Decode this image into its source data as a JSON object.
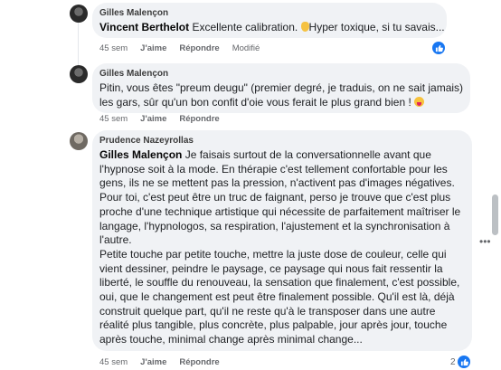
{
  "comments": [
    {
      "author": "Gilles Malençon",
      "mention": "Vincent Berthelot",
      "text": " Excellente calibration. ",
      "text_after": "Hyper toxique, si tu savais...",
      "emoji": "hand-emoji",
      "time": "45 sem",
      "like": "J'aime",
      "reply": "Répondre",
      "modified": "Modifié",
      "reaction_icon": "thumbs-up-icon"
    },
    {
      "author": "Gilles Malençon",
      "text_lines": [
        "Pitin, vous êtes \"preum deugu\" (premier degré, je traduis, on ne sait jamais)",
        "les gars, sûr qu'un bon confit d'oie vous ferait le plus grand bien ! "
      ],
      "emoji": "tongue-out-emoji",
      "time": "45 sem",
      "like": "J'aime",
      "reply": "Répondre"
    },
    {
      "author": "Prudence Nazeyrollas",
      "mention": "Gilles Malençon",
      "paragraph1_start": " Je faisais surtout de la conversationnelle avant que",
      "paragraph1_lines": [
        "l'hypnose soit à la mode. En thérapie c'est tellement confortable pour les",
        "gens, ils ne se mettent pas la pression, n'activent pas d'images négatives.",
        "Pour toi, c'est peut être un truc de faignant, perso je trouve que c'est plus",
        "proche d'une technique artistique qui nécessite de parfaitement maîtriser le",
        "langage, l'hypnologos, sa respiration, l'ajustement et la synchronisation à",
        "l'autre."
      ],
      "paragraph2_lines": [
        "Petite touche par petite touche, mettre la juste dose de couleur, celle qui",
        "vient dessiner, peindre le paysage, ce paysage qui nous fait ressentir la",
        "liberté, le souffle du renouveau, la sensation que finalement, c'est possible,",
        "oui, que le changement est peut être finalement possible. Qu'il est là, déjà",
        "construit quelque part, qu'il ne reste qu'à le transposer dans une autre",
        "réalité plus tangible, plus concrète, plus palpable, jour après jour, touche",
        "après touche, minimal change après minimal change..."
      ],
      "time": "45 sem",
      "like": "J'aime",
      "reply": "Répondre",
      "reaction_count": "2",
      "reaction_icon": "thumbs-up-icon"
    }
  ],
  "more_options": "•••"
}
